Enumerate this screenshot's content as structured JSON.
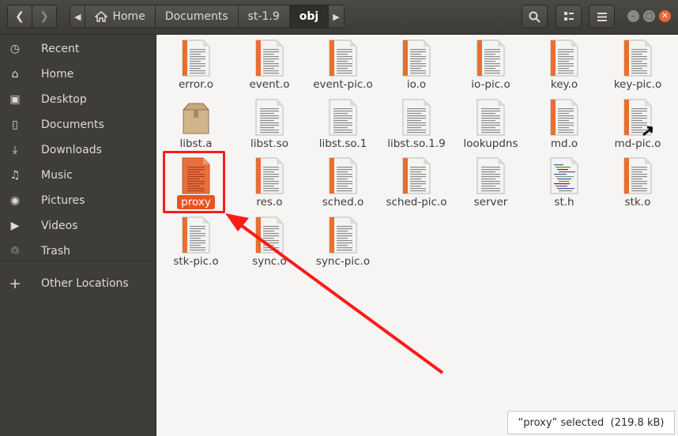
{
  "header": {
    "back_icon": "go-back-icon",
    "forward_icon": "go-forward-icon",
    "breadcrumb": [
      "Home",
      "Documents",
      "st-1.9",
      "obj"
    ],
    "active_crumb": "obj",
    "search_icon": "search-icon",
    "view_icon": "view-options-icon",
    "menu_icon": "hamburger-menu-icon"
  },
  "sidebar": {
    "items": [
      {
        "label": "Recent",
        "icon": "clock-icon"
      },
      {
        "label": "Home",
        "icon": "home-icon"
      },
      {
        "label": "Desktop",
        "icon": "folder-icon"
      },
      {
        "label": "Documents",
        "icon": "document-icon"
      },
      {
        "label": "Downloads",
        "icon": "download-icon"
      },
      {
        "label": "Music",
        "icon": "music-icon"
      },
      {
        "label": "Pictures",
        "icon": "camera-icon"
      },
      {
        "label": "Videos",
        "icon": "video-icon"
      },
      {
        "label": "Trash",
        "icon": "trash-icon"
      },
      {
        "label": "Other Locations",
        "icon": "plus-icon"
      }
    ]
  },
  "files": [
    {
      "name": "error.o",
      "type": "object"
    },
    {
      "name": "event.o",
      "type": "object"
    },
    {
      "name": "event-pic.o",
      "type": "object"
    },
    {
      "name": "io.o",
      "type": "object"
    },
    {
      "name": "io-pic.o",
      "type": "object"
    },
    {
      "name": "key.o",
      "type": "object"
    },
    {
      "name": "key-pic.o",
      "type": "object"
    },
    {
      "name": "libst.a",
      "type": "archive"
    },
    {
      "name": "libst.so",
      "type": "text"
    },
    {
      "name": "libst.so.1",
      "type": "text"
    },
    {
      "name": "libst.so.1.9",
      "type": "text"
    },
    {
      "name": "lookupdns",
      "type": "text"
    },
    {
      "name": "md.o",
      "type": "object"
    },
    {
      "name": "md-pic.o",
      "type": "object-link"
    },
    {
      "name": "proxy",
      "type": "selected"
    },
    {
      "name": "res.o",
      "type": "object"
    },
    {
      "name": "sched.o",
      "type": "object"
    },
    {
      "name": "sched-pic.o",
      "type": "object"
    },
    {
      "name": "server",
      "type": "text"
    },
    {
      "name": "st.h",
      "type": "header"
    },
    {
      "name": "stk.o",
      "type": "object"
    },
    {
      "name": "stk-pic.o",
      "type": "object"
    },
    {
      "name": "sync.o",
      "type": "object"
    },
    {
      "name": "sync-pic.o",
      "type": "object"
    }
  ],
  "status": "“proxy” selected  (219.8 kB)",
  "colors": {
    "accent": "#e95420",
    "annotation": "#ff1a1a",
    "sidebar": "#3e3d39"
  }
}
